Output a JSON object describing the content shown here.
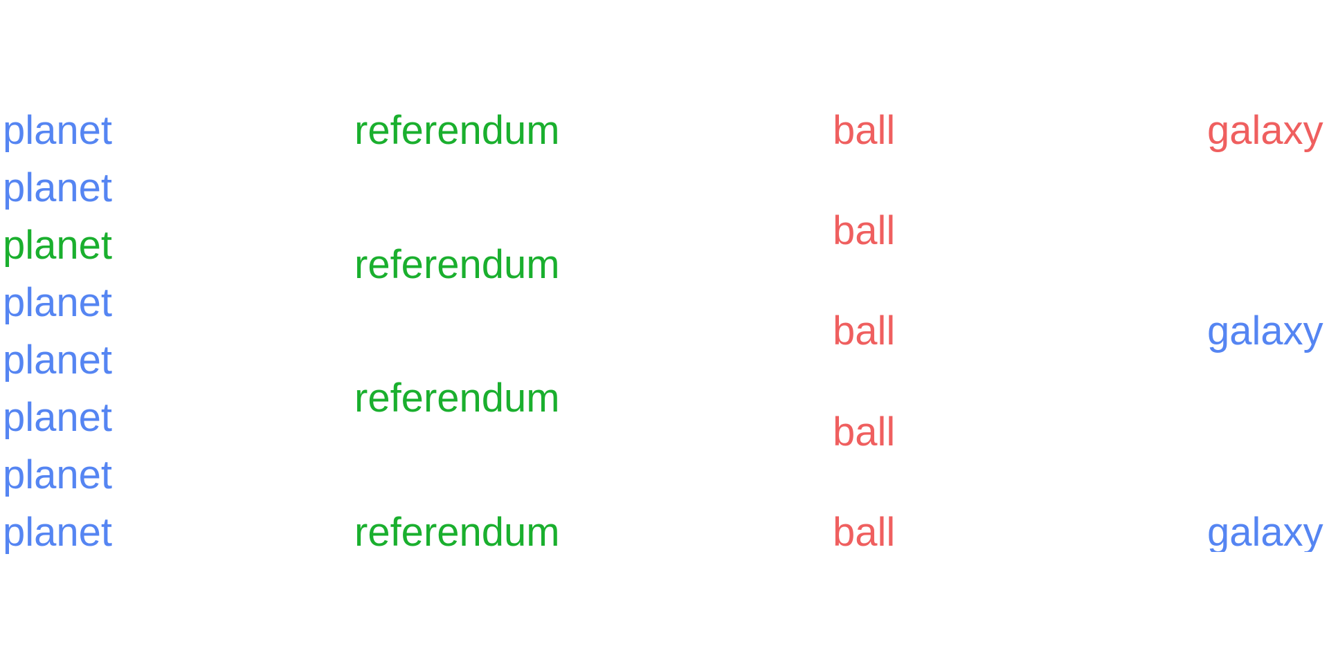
{
  "colors": {
    "blue": "#5585f2",
    "green": "#1aaf2e",
    "red": "#ef5f5f"
  },
  "columns": [
    {
      "name": "planet-column",
      "words": [
        {
          "text": "planet",
          "color": "blue"
        },
        {
          "text": "planet",
          "color": "blue"
        },
        {
          "text": "planet",
          "color": "green"
        },
        {
          "text": "planet",
          "color": "blue"
        },
        {
          "text": "planet",
          "color": "blue"
        },
        {
          "text": "planet",
          "color": "blue"
        },
        {
          "text": "planet",
          "color": "blue"
        },
        {
          "text": "planet",
          "color": "blue"
        }
      ]
    },
    {
      "name": "referendum-column",
      "words": [
        {
          "text": "referendum",
          "color": "green"
        },
        {
          "text": "referendum",
          "color": "green"
        },
        {
          "text": "referendum",
          "color": "green"
        },
        {
          "text": "referendum",
          "color": "green"
        }
      ]
    },
    {
      "name": "ball-column",
      "words": [
        {
          "text": "ball",
          "color": "red"
        },
        {
          "text": "ball",
          "color": "red"
        },
        {
          "text": "ball",
          "color": "red"
        },
        {
          "text": "ball",
          "color": "red"
        },
        {
          "text": "ball",
          "color": "red"
        }
      ]
    },
    {
      "name": "galaxy-column",
      "words": [
        {
          "text": "galaxy",
          "color": "red"
        },
        {
          "text": "galaxy",
          "color": "blue"
        },
        {
          "text": "galaxy",
          "color": "blue"
        }
      ]
    }
  ]
}
